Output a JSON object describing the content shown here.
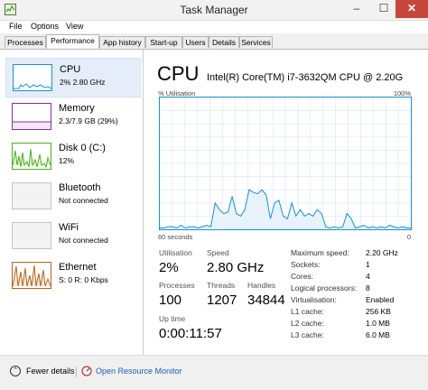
{
  "window": {
    "title": "Task Manager",
    "min_glyph": "–",
    "max_glyph": "☐",
    "close_glyph": "✕"
  },
  "menu": [
    "File",
    "Options",
    "View"
  ],
  "tabs": [
    "Processes",
    "Performance",
    "App history",
    "Start-up",
    "Users",
    "Details",
    "Services"
  ],
  "active_tab": "Performance",
  "sidebar": [
    {
      "name": "CPU",
      "sub": "2% 2.80 GHz",
      "color": "#1a8fd5",
      "selected": true
    },
    {
      "name": "Memory",
      "sub": "2.3/7.9 GB (29%)",
      "color": "#8b2ca0"
    },
    {
      "name": "Disk 0 (C:)",
      "sub": "12%",
      "color": "#4caf1d"
    },
    {
      "name": "Bluetooth",
      "sub": "Not connected",
      "color": "#a9a9a9"
    },
    {
      "name": "WiFi",
      "sub": "Not connected",
      "color": "#a9a9a9"
    },
    {
      "name": "Ethernet",
      "sub": "S: 0 R: 0 Kbps",
      "color": "#b5651d"
    }
  ],
  "cpu": {
    "title": "CPU",
    "model": "Intel(R) Core(TM) i7-3632QM CPU @ 2.20G",
    "util_label": "% Utilisation",
    "util_max": "100%",
    "x_left": "60 seconds",
    "x_right": "0",
    "graph_color": "#1a8fd5",
    "fill_color": "#e8f2fb",
    "utilisation_history_pct": [
      1,
      1,
      2,
      2,
      1,
      3,
      1,
      2,
      2,
      1,
      2,
      3,
      2,
      20,
      15,
      12,
      13,
      25,
      12,
      10,
      15,
      30,
      28,
      27,
      30,
      26,
      8,
      20,
      22,
      10,
      8,
      20,
      10,
      15,
      10,
      12,
      10,
      15,
      12,
      2,
      1,
      2,
      1,
      2,
      12,
      8,
      1,
      2,
      3,
      1,
      2,
      1,
      2,
      1,
      3,
      2,
      1,
      2,
      1,
      1
    ],
    "stats": {
      "utilisation_label": "Utilisation",
      "utilisation": "2%",
      "speed_label": "Speed",
      "speed": "2.80 GHz",
      "processes_label": "Processes",
      "processes": "100",
      "threads_label": "Threads",
      "threads": "1207",
      "handles_label": "Handles",
      "handles": "34844",
      "uptime_label": "Up time",
      "uptime": "0:00:11:57"
    },
    "info": [
      {
        "label": "Maximum speed:",
        "value": "2.20 GHz"
      },
      {
        "label": "Sockets:",
        "value": "1"
      },
      {
        "label": "Cores:",
        "value": "4"
      },
      {
        "label": "Logical processors:",
        "value": "8"
      },
      {
        "label": "Virtualisation:",
        "value": "Enabled"
      },
      {
        "label": "L1 cache:",
        "value": "256 KB"
      },
      {
        "label": "L2 cache:",
        "value": "1.0 MB"
      },
      {
        "label": "L3 cache:",
        "value": "6.0 MB"
      }
    ]
  },
  "footer": {
    "fewer_details": "Fewer details",
    "open_monitor": "Open Resource Monitor",
    "collapse_glyph": "⌃"
  }
}
